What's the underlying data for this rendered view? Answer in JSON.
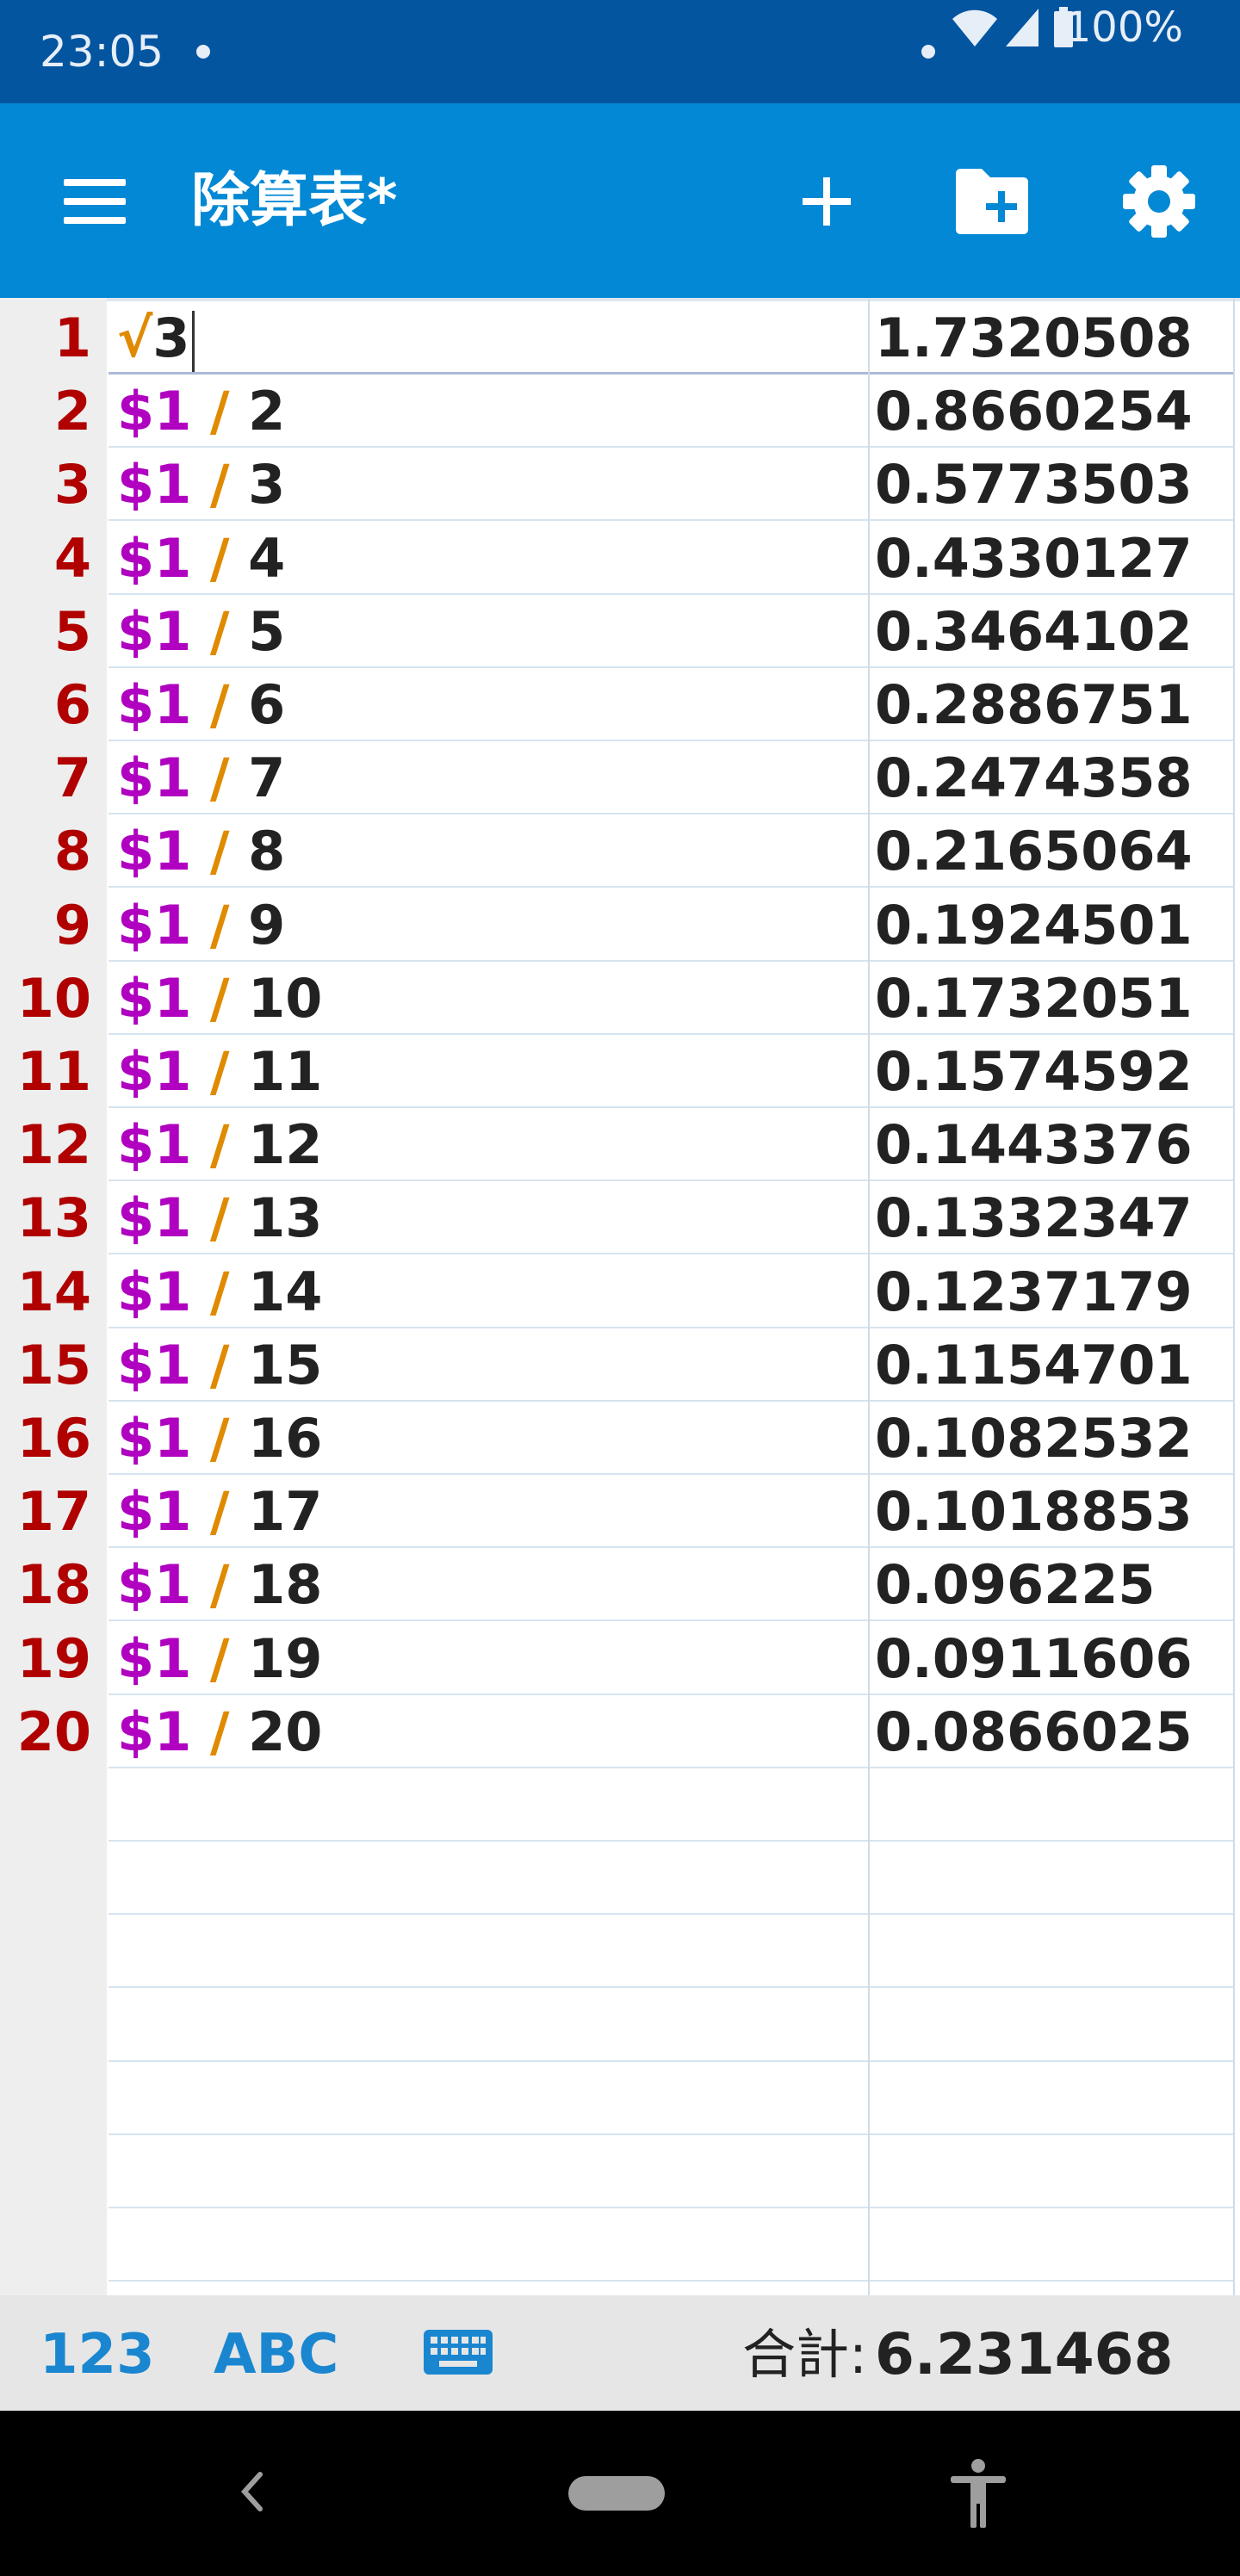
{
  "status_bar": {
    "time": "23:05",
    "battery": "100%"
  },
  "app_bar": {
    "title": "除算表*",
    "icons": [
      "menu-icon",
      "add-icon",
      "folder-add-icon",
      "gear-icon"
    ]
  },
  "sheet": {
    "rows": [
      {
        "num": "1",
        "ref": "",
        "op": "√",
        "arg": "3",
        "result": "1.7320508",
        "active": true
      },
      {
        "num": "2",
        "ref": "$1",
        "op": "/",
        "arg": "2",
        "result": "0.8660254"
      },
      {
        "num": "3",
        "ref": "$1",
        "op": "/",
        "arg": "3",
        "result": "0.5773503"
      },
      {
        "num": "4",
        "ref": "$1",
        "op": "/",
        "arg": "4",
        "result": "0.4330127"
      },
      {
        "num": "5",
        "ref": "$1",
        "op": "/",
        "arg": "5",
        "result": "0.3464102"
      },
      {
        "num": "6",
        "ref": "$1",
        "op": "/",
        "arg": "6",
        "result": "0.2886751"
      },
      {
        "num": "7",
        "ref": "$1",
        "op": "/",
        "arg": "7",
        "result": "0.2474358"
      },
      {
        "num": "8",
        "ref": "$1",
        "op": "/",
        "arg": "8",
        "result": "0.2165064"
      },
      {
        "num": "9",
        "ref": "$1",
        "op": "/",
        "arg": "9",
        "result": "0.1924501"
      },
      {
        "num": "10",
        "ref": "$1",
        "op": "/",
        "arg": "10",
        "result": "0.1732051"
      },
      {
        "num": "11",
        "ref": "$1",
        "op": "/",
        "arg": "11",
        "result": "0.1574592"
      },
      {
        "num": "12",
        "ref": "$1",
        "op": "/",
        "arg": "12",
        "result": "0.1443376"
      },
      {
        "num": "13",
        "ref": "$1",
        "op": "/",
        "arg": "13",
        "result": "0.1332347"
      },
      {
        "num": "14",
        "ref": "$1",
        "op": "/",
        "arg": "14",
        "result": "0.1237179"
      },
      {
        "num": "15",
        "ref": "$1",
        "op": "/",
        "arg": "15",
        "result": "0.1154701"
      },
      {
        "num": "16",
        "ref": "$1",
        "op": "/",
        "arg": "16",
        "result": "0.1082532"
      },
      {
        "num": "17",
        "ref": "$1",
        "op": "/",
        "arg": "17",
        "result": "0.1018853"
      },
      {
        "num": "18",
        "ref": "$1",
        "op": "/",
        "arg": "18",
        "result": "0.096225"
      },
      {
        "num": "19",
        "ref": "$1",
        "op": "/",
        "arg": "19",
        "result": "0.0911606"
      },
      {
        "num": "20",
        "ref": "$1",
        "op": "/",
        "arg": "20",
        "result": "0.0866025"
      }
    ]
  },
  "bottom_bar": {
    "num_keyboard": "123",
    "abc_keyboard": "ABC",
    "sum_label": "合計:",
    "sum_value": "6.231468"
  },
  "colors": {
    "status_bar": "#0355a0",
    "app_bar": "#0288d4",
    "row_number": "#b00000",
    "cell_reference": "#b000c0",
    "operator": "#e08a00",
    "keyboard_toggle": "#1a86d0"
  },
  "nav_bar": {
    "icons": [
      "back-icon",
      "home-pill",
      "accessibility-icon"
    ]
  }
}
